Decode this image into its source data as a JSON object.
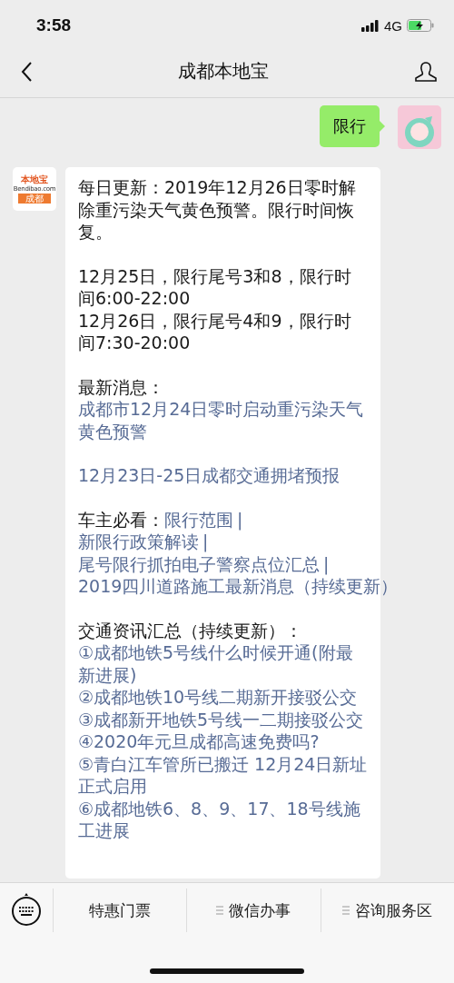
{
  "status_bar": {
    "time": "3:58",
    "network": "4G",
    "battery_charging": true
  },
  "nav": {
    "title": "成都本地宝"
  },
  "messages": [
    {
      "kind": "outgoing",
      "text": "限行"
    },
    {
      "kind": "incoming",
      "logo": {
        "top": "本地宝",
        "middle": "Bendibao.com",
        "bottom": "成都"
      },
      "sections": [
        [
          [
            {
              "kind": "text",
              "text": "每日更新：2019年12月26日零时解除重污染天气黄色预警。限行时间恢复。"
            }
          ]
        ],
        [
          [
            {
              "kind": "text",
              "text": "12月25日，限行尾号3和8，限行时间6:00-22:00"
            }
          ],
          [
            {
              "kind": "text",
              "text": "12月26日，限行尾号4和9，限行时间7:30-20:00"
            }
          ]
        ],
        [
          [
            {
              "kind": "text",
              "text": "最新消息："
            }
          ],
          [
            {
              "kind": "link",
              "text": "成都市12月24日零时启动重污染天气黄色预警"
            }
          ]
        ],
        [
          [
            {
              "kind": "link",
              "text": "12月23日-25日成都交通拥堵预报"
            }
          ]
        ],
        [
          [
            {
              "kind": "text",
              "text": "车主必看："
            },
            {
              "kind": "link",
              "text": "限行范围"
            },
            {
              "kind": "separator",
              "text": "|"
            },
            {
              "kind": "link",
              "text": "新限行政策解读"
            },
            {
              "kind": "separator",
              "text": "|"
            },
            {
              "kind": "link",
              "text": "尾号限行抓拍电子警察点位汇总"
            },
            {
              "kind": "separator",
              "text": "|"
            },
            {
              "kind": "link",
              "text": "2019四川道路施工最新消息（持续更新）"
            }
          ]
        ],
        [
          [
            {
              "kind": "text",
              "text": "交通资讯汇总（持续更新）："
            }
          ],
          [
            {
              "kind": "link",
              "text": "①成都地铁5号线什么时候开通(附最新进展)"
            }
          ],
          [
            {
              "kind": "link",
              "text": "②成都地铁10号线二期新开接驳公交"
            }
          ],
          [
            {
              "kind": "link",
              "text": "③成都新开地铁5号线一二期接驳公交"
            }
          ],
          [
            {
              "kind": "link",
              "text": "④2020年元旦成都高速免费吗?"
            }
          ],
          [
            {
              "kind": "link",
              "text": "⑤青白江车管所已搬迁 12月24日新址正式启用"
            }
          ],
          [
            {
              "kind": "link",
              "text": "⑥成都地铁6、8、9、17、18号线施工进展"
            }
          ]
        ]
      ]
    }
  ],
  "menu": [
    {
      "label": "特惠门票",
      "has_submenu": false
    },
    {
      "label": "微信办事",
      "has_submenu": true
    },
    {
      "label": "咨询服务区",
      "has_submenu": true
    }
  ]
}
